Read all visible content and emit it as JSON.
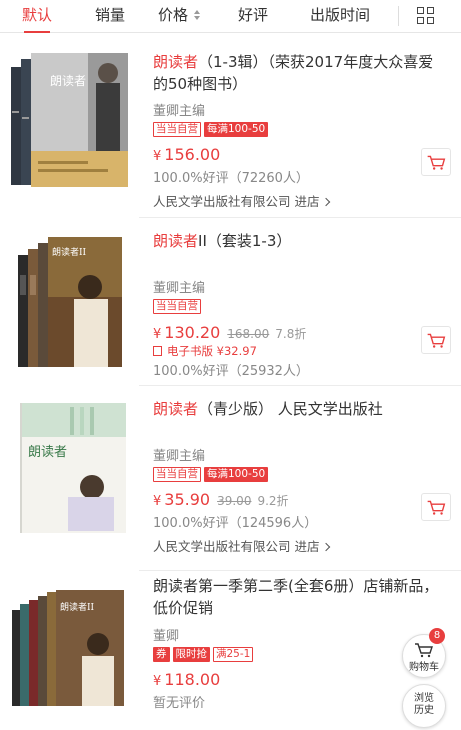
{
  "sort_bar": {
    "items": [
      "默认",
      "销量",
      "价格",
      "好评",
      "出版时间"
    ],
    "active_index": 0,
    "view_icon": "grid-icon"
  },
  "products": [
    {
      "title_highlight": "朗读者",
      "title_rest": "（1-3辑）（荣获2017年度大众喜爱的50种图书）",
      "cover_title": "朗读者",
      "author": "董卿主编",
      "tags": [
        "当当自营",
        "每满100-50"
      ],
      "price_symbol": "¥",
      "price": "156.00",
      "rating": "100.0%好评（72260人）",
      "shop": "人民文学出版社有限公司 进店"
    },
    {
      "title_highlight": "朗读者",
      "title_rest": "II（套装1-3）",
      "cover_title": "朗读者II",
      "author": "董卿主编",
      "tags": [
        "当当自营"
      ],
      "price_symbol": "¥",
      "price": "130.20",
      "original_price": "168.00",
      "discount": "7.8折",
      "ebook": "电子书版 ¥32.97",
      "rating": "100.0%好评（25932人）"
    },
    {
      "title_highlight": "朗读者",
      "title_rest": "（青少版） 人民文学出版社",
      "cover_title": "朗读者",
      "author": "董卿主编",
      "tags": [
        "当当自营",
        "每满100-50"
      ],
      "price_symbol": "¥",
      "price": "35.90",
      "original_price": "39.00",
      "discount": "9.2折",
      "rating": "100.0%好评（124596人）",
      "shop": "人民文学出版社有限公司 进店"
    },
    {
      "title_highlight": "",
      "title_rest": "朗读者第一季第二季(全套6册）店铺新品，低价促销",
      "cover_title": "朗读者II",
      "author": "董卿",
      "tags": [
        "券",
        "限时抢",
        "满25-1"
      ],
      "price_symbol": "¥",
      "price": "118.00",
      "rating": "暂无评价"
    }
  ],
  "floating": {
    "cart_label": "购物车",
    "cart_count": "8",
    "history_label_1": "浏览",
    "history_label_2": "历史"
  },
  "colors": {
    "accent": "#e83e3e",
    "text": "#333333",
    "muted": "#888888"
  }
}
